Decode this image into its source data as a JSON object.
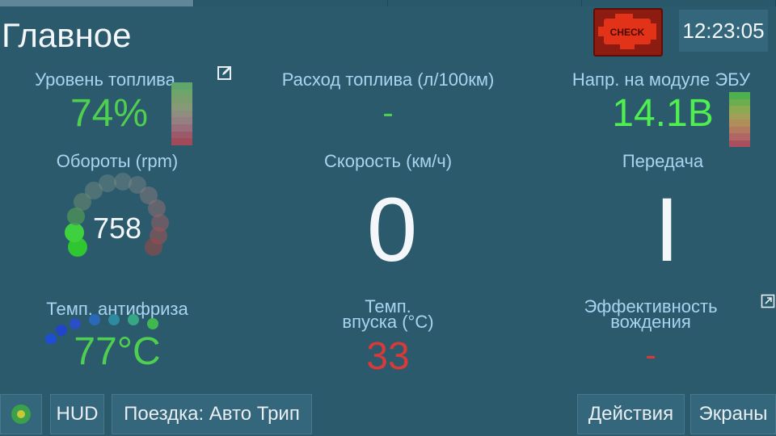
{
  "tabs": [
    {
      "active": true
    },
    {
      "active": false
    },
    {
      "active": false
    },
    {
      "active": false
    }
  ],
  "header": {
    "title": "Главное",
    "check_engine_label": "CHECK",
    "clock": "12:23:05"
  },
  "gauges": {
    "fuel_level": {
      "label": "Уровень топлива",
      "value": "74%",
      "value_color": "#4fcf4f",
      "level": 0.74
    },
    "fuel_consumption": {
      "label": "Расход топлива (л/100км)",
      "value": "-",
      "value_color": "#4fcf4f"
    },
    "ecu_voltage": {
      "label": "Напр. на модуле ЭБУ",
      "value": "14.1В",
      "value_color": "#4fef4f"
    },
    "rpm": {
      "label": "Обороты (rpm)",
      "value": "758"
    },
    "speed": {
      "label": "Скорость (км/ч)",
      "value": "0"
    },
    "gear": {
      "label": "Передача",
      "value": "I"
    },
    "coolant_temp": {
      "label": "Темп. антифриза",
      "value": "77°C",
      "value_color": "#4fcf4f"
    },
    "intake_temp": {
      "label_line1": "Темп.",
      "label_line2": "впуска (°C)",
      "value": "33",
      "value_color": "#d83a3a"
    },
    "driving_efficiency": {
      "label_line1": "Эффективность",
      "label_line2": "вождения",
      "value": "-",
      "value_color": "#d83a3a"
    }
  },
  "bottom": {
    "status_icon": "green-dot-icon",
    "hud": "HUD",
    "trip": "Поездка: Авто Трип",
    "actions": "Действия",
    "screens": "Экраны"
  },
  "colors": {
    "background": "#2b5a6d",
    "label": "#a9d3ef",
    "check_engine": "#8c1c12"
  }
}
